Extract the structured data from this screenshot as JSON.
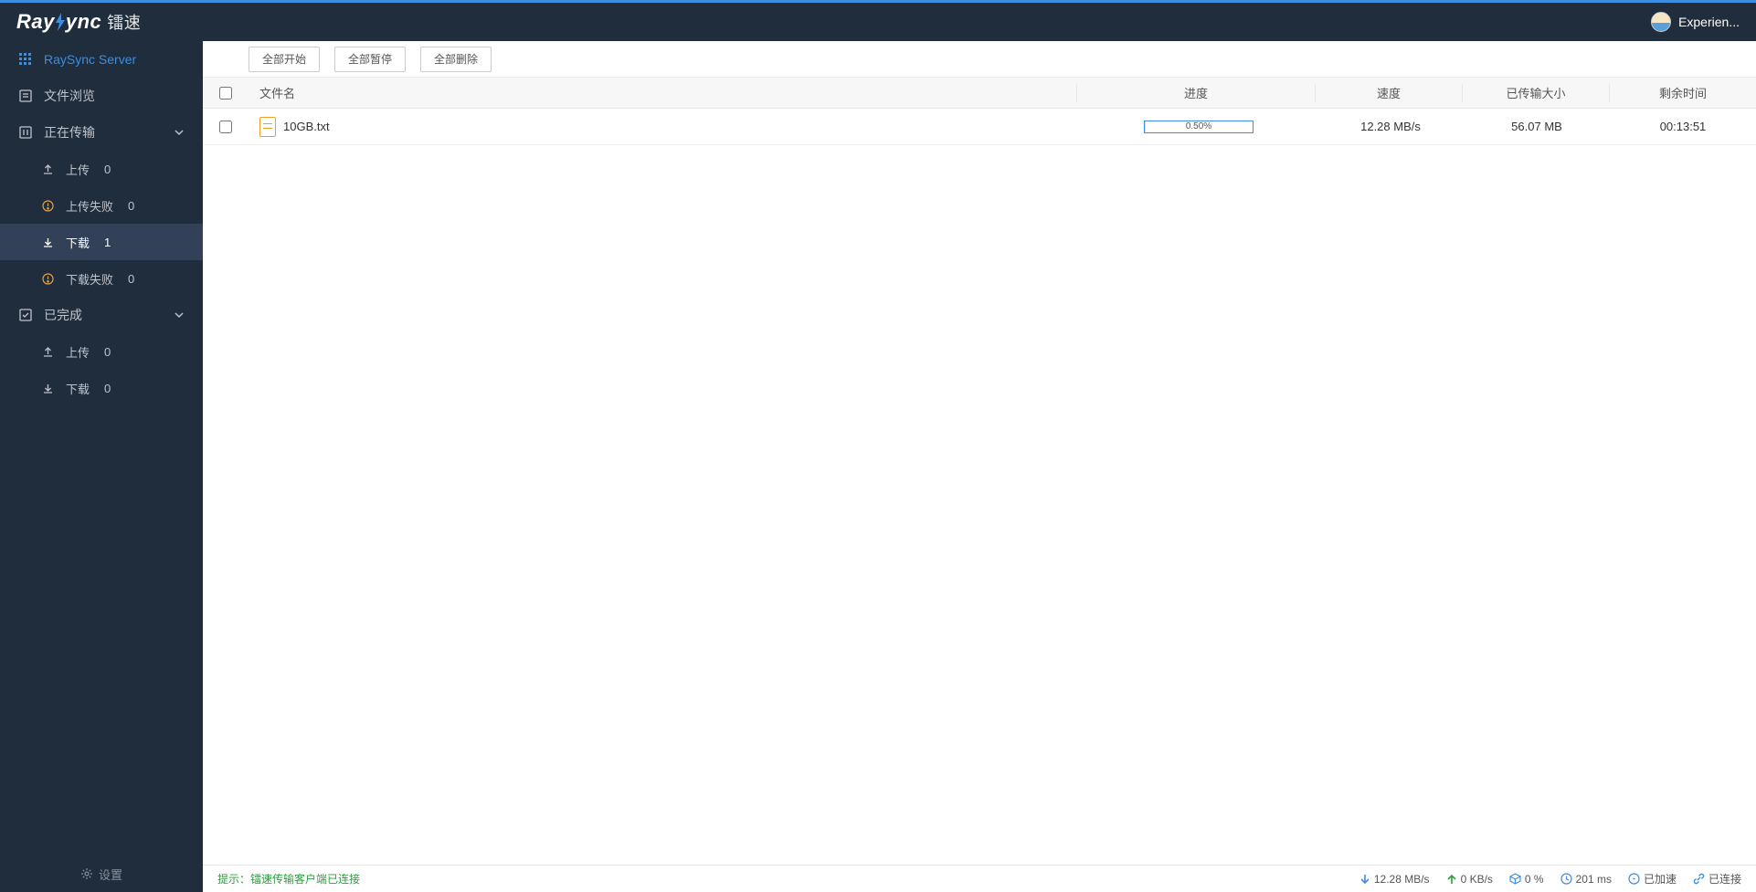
{
  "header": {
    "brand_en": "Ray",
    "brand_en2": "ync",
    "brand_cn": "镭速",
    "user_name": "Experien..."
  },
  "sidebar": {
    "server": {
      "label": "RaySync Server"
    },
    "browse": {
      "label": "文件浏览"
    },
    "transferring": {
      "label": "正在传输"
    },
    "upload": {
      "label": "上传",
      "count": "0"
    },
    "upload_fail": {
      "label": "上传失败",
      "count": "0"
    },
    "download": {
      "label": "下载",
      "count": "1"
    },
    "download_fail": {
      "label": "下载失败",
      "count": "0"
    },
    "done": {
      "label": "已完成"
    },
    "done_upload": {
      "label": "上传",
      "count": "0"
    },
    "done_download": {
      "label": "下载",
      "count": "0"
    },
    "settings": {
      "label": "设置"
    }
  },
  "toolbar": {
    "start_all": "全部开始",
    "pause_all": "全部暂停",
    "delete_all": "全部删除"
  },
  "table": {
    "headers": {
      "name": "文件名",
      "progress": "进度",
      "speed": "速度",
      "size": "已传输大小",
      "time": "剩余时间"
    },
    "rows": [
      {
        "name": "10GB.txt",
        "progress_text": "0.50%",
        "progress_pct": 0.5,
        "speed": "12.28 MB/s",
        "size": "56.07 MB",
        "time": "00:13:51"
      }
    ]
  },
  "statusbar": {
    "hint_label": "提示：",
    "hint_text": "镭速传输客户端已连接",
    "down_speed": "12.28 MB/s",
    "up_speed": "0 KB/s",
    "loss": "0 %",
    "latency": "201 ms",
    "accel": "已加速",
    "conn": "已连接"
  }
}
